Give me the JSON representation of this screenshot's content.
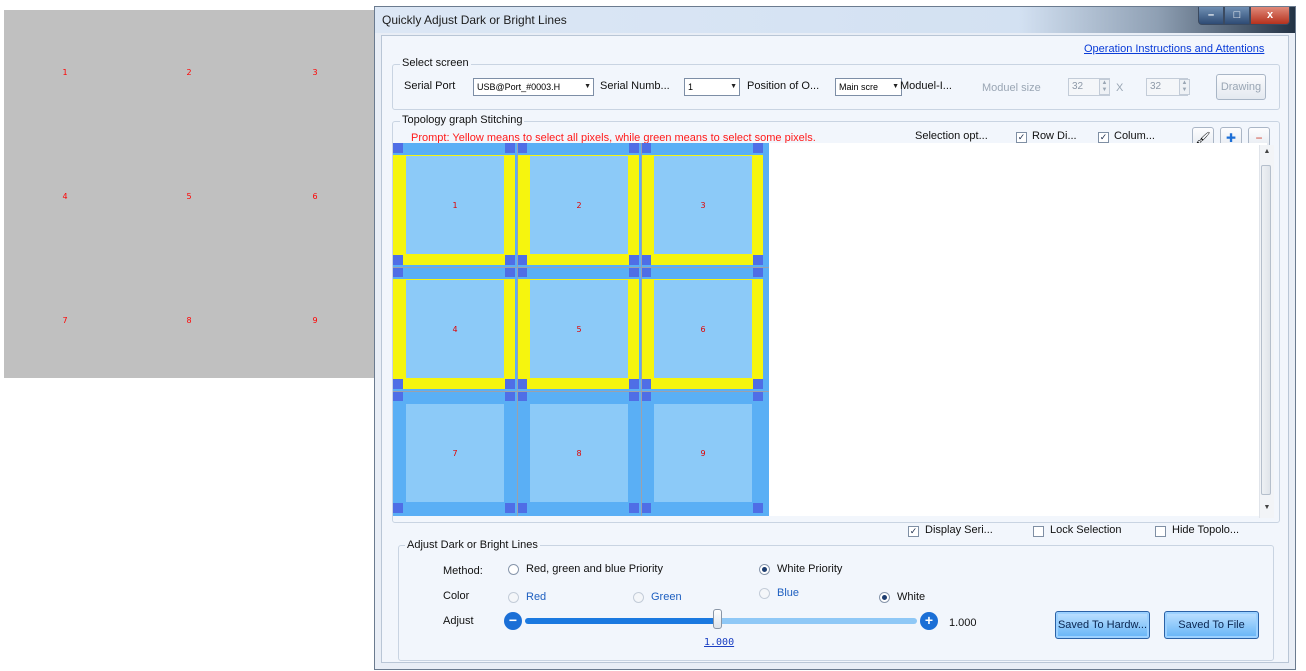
{
  "preview": {
    "numbers": [
      "1",
      "2",
      "3",
      "4",
      "5",
      "6",
      "7",
      "8",
      "9"
    ]
  },
  "window": {
    "title": "Quickly Adjust Dark or Bright Lines",
    "buttons": {
      "minimize": "–",
      "maximize": "□",
      "close": "x"
    }
  },
  "header": {
    "instructions_link": "Operation Instructions and Attentions"
  },
  "select_screen": {
    "legend": "Select screen",
    "serial_port_label": "Serial Port",
    "serial_port_value": "USB@Port_#0003.H",
    "serial_number_label": "Serial Numb...",
    "serial_number_value": "1",
    "position_label": "Position of O...",
    "position_value": "Main scre",
    "module_label": "Moduel-I...",
    "module_size_label": "Moduel size",
    "module_w": "32",
    "times": "X",
    "module_h": "32",
    "drawing_button": "Drawing"
  },
  "topology": {
    "legend": "Topology graph Stitching",
    "prompt": "Prompt: Yellow means to select all pixels, while green means to select some pixels.",
    "selection_label": "Selection opt...",
    "row_label": "Row Di...",
    "column_label": "Colum...",
    "row_checked": true,
    "column_checked": true,
    "cell_numbers": [
      "1",
      "2",
      "3",
      "4",
      "5",
      "6",
      "7",
      "8",
      "9"
    ],
    "tool_icons": [
      "brush-icon",
      "add-icon",
      "remove-icon"
    ]
  },
  "options": {
    "display_serial": "Display Seri...",
    "lock_selection": "Lock Selection",
    "hide_topology": "Hide Topolo...",
    "display_serial_checked": true,
    "lock_selection_checked": false,
    "hide_topology_checked": false
  },
  "adjust": {
    "legend": "Adjust Dark or Bright Lines",
    "method_label": "Method:",
    "method_rgb": "Red, green and blue Priority",
    "method_white": "White Priority",
    "method_selected": "White Priority",
    "color_label": "Color",
    "colors": [
      "Red",
      "Green",
      "Blue",
      "White"
    ],
    "color_selected": "White",
    "adjust_label": "Adjust",
    "value": "1.000",
    "slider_value": "1.000",
    "slider_fraction": 0.49,
    "save_hardware": "Saved To Hardw...",
    "save_file": "Saved To File"
  }
}
